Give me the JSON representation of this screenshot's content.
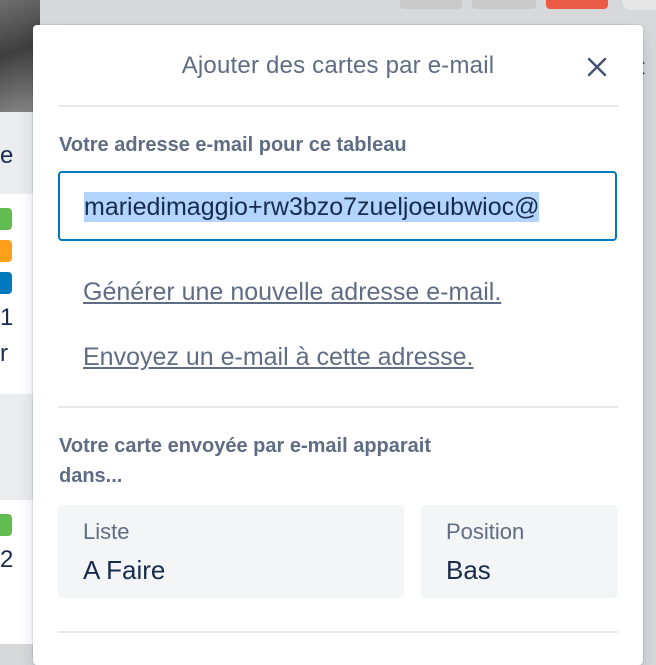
{
  "background": {
    "top_buttons": [
      {
        "color": "#c9c9c9"
      },
      {
        "color": "#c9c9c9"
      },
      {
        "color": "#eb5a46"
      }
    ],
    "list_fragments": [
      "e",
      "1",
      "r",
      "2"
    ],
    "label_colors": [
      "#61bd4f",
      "#ff9f1a",
      "#0079bf",
      "#61bd4f"
    ],
    "chevron": "‹"
  },
  "popover": {
    "title": "Ajouter des cartes par e-mail",
    "close_icon": "close-icon",
    "email_section_label": "Votre adresse e-mail pour ce tableau",
    "email_value": "mariedimaggio+rw3bzo7zueljoeubwioc@",
    "generate_link": "Générer une nouvelle adresse e-mail.",
    "send_link": "Envoyez un e-mail à cette adresse.",
    "destination_label_line1": "Votre carte envoyée par e-mail apparait",
    "destination_label_line2": "dans...",
    "list_select": {
      "label": "Liste",
      "value": "A Faire"
    },
    "position_select": {
      "label": "Position",
      "value": "Bas"
    }
  },
  "colors": {
    "accent": "#0079bf",
    "selection": "#b3d4fd",
    "muted_text": "#5e6c84",
    "body_text": "#172b4d"
  }
}
